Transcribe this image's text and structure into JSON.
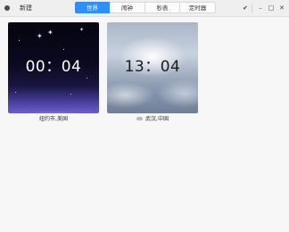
{
  "header": {
    "new_label": "新建",
    "tabs": [
      {
        "label": "世界",
        "active": true
      },
      {
        "label": "闹钟",
        "active": false
      },
      {
        "label": "秒表",
        "active": false
      },
      {
        "label": "定时器",
        "active": false
      }
    ],
    "controls": {
      "check": "✔",
      "minimize": "–",
      "maximize": "□",
      "close": "✕"
    },
    "accent_color": "#2f8ef8"
  },
  "clocks": [
    {
      "time": "00：04",
      "city": "纽约市,美国",
      "theme": "night"
    },
    {
      "time": "13：04",
      "city": "武汉,中国",
      "theme": "day",
      "icon": "cloud-icon"
    }
  ]
}
